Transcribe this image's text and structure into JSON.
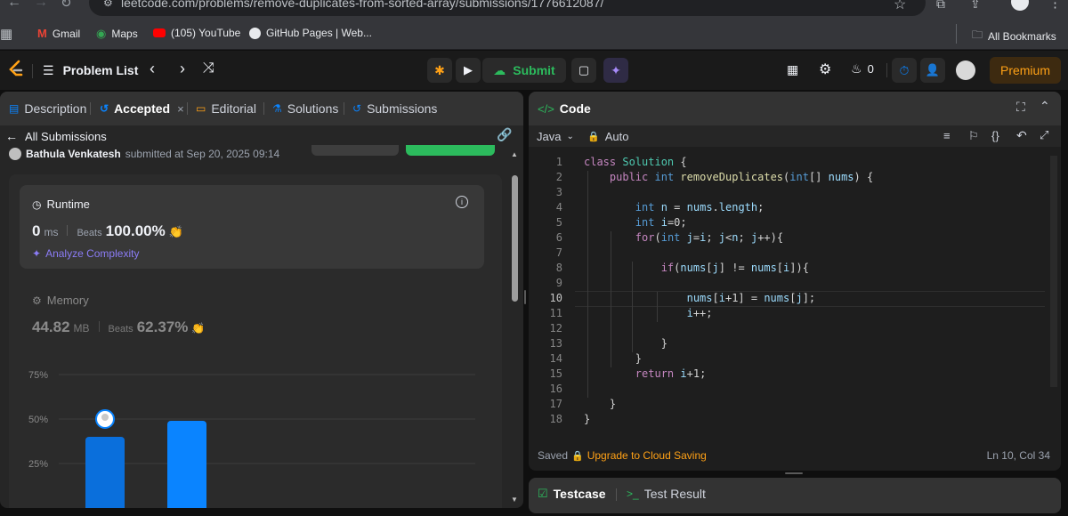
{
  "browser": {
    "url": "leetcode.com/problems/remove-duplicates-from-sorted-array/submissions/1776612087/",
    "bookmarks": [
      "Gmail",
      "Maps",
      "(105) YouTube",
      "GitHub Pages | Web..."
    ],
    "all_bookmarks": "All Bookmarks"
  },
  "header": {
    "problem_list": "Problem List",
    "submit": "Submit",
    "streak": "0",
    "premium": "Premium"
  },
  "left": {
    "tabs": [
      "Description",
      "Accepted",
      "Editorial",
      "Solutions",
      "Submissions"
    ],
    "all_submissions": "All Submissions",
    "user": "Bathula Venkatesh",
    "submitted_text": "submitted at Sep 20, 2025 09:14",
    "runtime": {
      "label": "Runtime",
      "value": "0",
      "unit": "ms",
      "beats_label": "Beats",
      "beats": "100.00%",
      "analyze": "Analyze Complexity"
    },
    "memory": {
      "label": "Memory",
      "value": "44.82",
      "unit": "MB",
      "beats_label": "Beats",
      "beats": "62.37%"
    },
    "chart": {
      "ticks": [
        "75%",
        "50%",
        "25%"
      ],
      "bars": [
        40,
        49
      ]
    }
  },
  "right": {
    "title": "Code",
    "language": "Java",
    "auto": "Auto",
    "code": [
      "class Solution {",
      "    public int removeDuplicates(int[] nums) {",
      "",
      "        int n = nums.length;",
      "        int i=0;",
      "        for(int j=i; j<n; j++){",
      "",
      "            if(nums[j] != nums[i]){",
      "",
      "                nums[i+1] = nums[j];",
      "                i++;",
      "",
      "            }",
      "        }",
      "        return i+1;",
      "",
      "    }",
      "}"
    ],
    "saved": "Saved",
    "upgrade": "Upgrade to Cloud Saving",
    "cursor": "Ln 10, Col 34"
  },
  "bottom": {
    "testcase": "Testcase",
    "test_result": "Test Result"
  },
  "colors": {
    "accent_green": "#2cbb5d",
    "blue": "#0a84ff",
    "premium": "#ffa116"
  }
}
